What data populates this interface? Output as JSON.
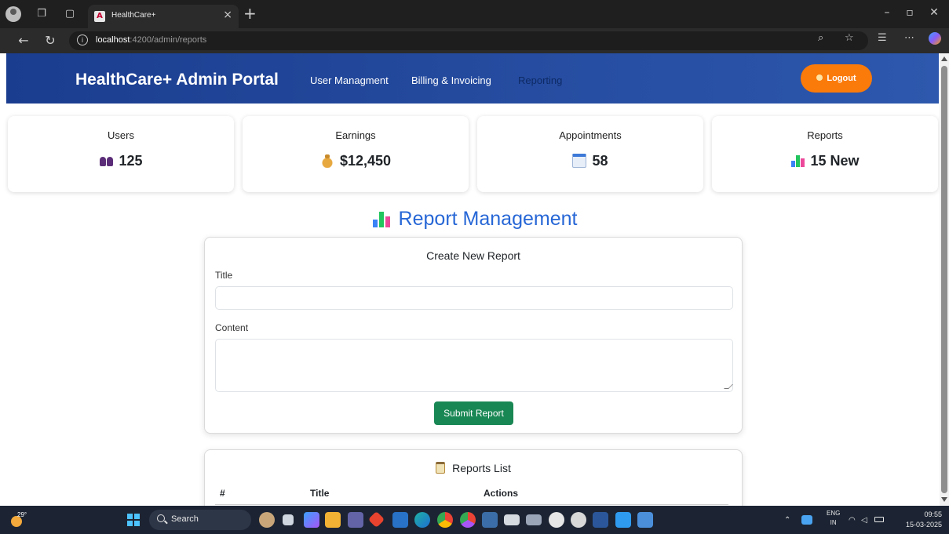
{
  "browser": {
    "tab_title": "HealthCare+",
    "url_host": "localhost",
    "url_path": ":4200/admin/reports"
  },
  "header": {
    "brand": "HealthCare+ Admin Portal",
    "nav": [
      {
        "label": "User Managment"
      },
      {
        "label": "Billing & Invoicing"
      },
      {
        "label": "Reporting",
        "active": true
      }
    ],
    "logout_label": "Logout"
  },
  "stats": [
    {
      "label": "Users",
      "value": "125",
      "icon": "users-icon"
    },
    {
      "label": "Earnings",
      "value": "$12,450",
      "icon": "money-bag-icon"
    },
    {
      "label": "Appointments",
      "value": "58",
      "icon": "calendar-icon"
    },
    {
      "label": "Reports",
      "value": "15 New",
      "icon": "bar-chart-icon"
    }
  ],
  "report_management": {
    "title": "Report Management",
    "form": {
      "heading": "Create New Report",
      "title_label": "Title",
      "title_value": "",
      "content_label": "Content",
      "content_value": "",
      "submit_label": "Submit Report"
    },
    "list": {
      "heading": "Reports List",
      "columns": [
        "#",
        "Title",
        "Actions"
      ]
    }
  },
  "taskbar": {
    "weather_temp": "29°",
    "search_label": "Search",
    "lang_line1": "ENG",
    "lang_line2": "IN",
    "time": "09:55",
    "date": "15-03-2025"
  },
  "colors": {
    "header_gradient_start": "#1b3d8f",
    "header_gradient_end": "#2d58ad",
    "logout_orange": "#fa7a0a",
    "title_blue": "#2767d6",
    "submit_green": "#198754"
  }
}
